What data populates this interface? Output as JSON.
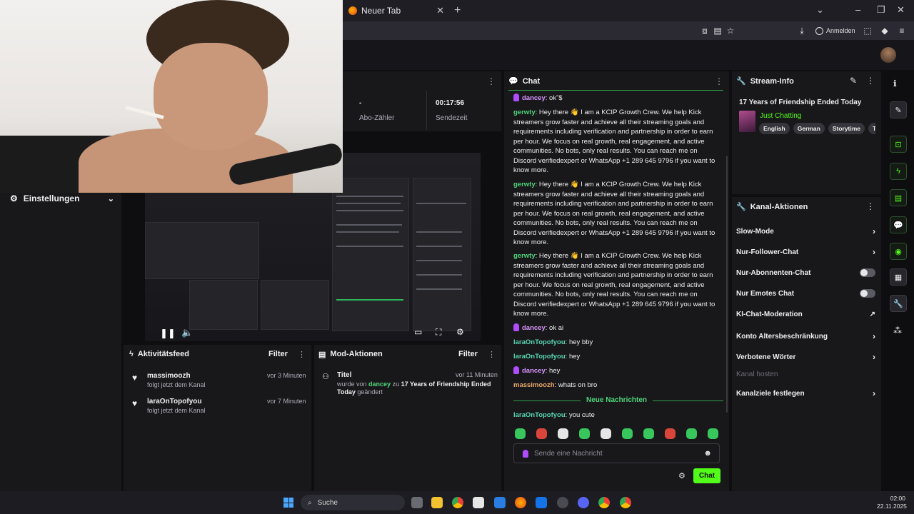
{
  "browser": {
    "tab_title": "Neuer Tab",
    "signin_label": "Anmelden"
  },
  "sidebar": {
    "settings_label": "Einstellungen"
  },
  "stats": {
    "subs_value": "-",
    "subs_label": "Abo-Zähler",
    "time_value": "00:17:56",
    "time_label": "Sendezeit"
  },
  "activity": {
    "title": "Aktivitätsfeed",
    "filter_label": "Filter",
    "items": [
      {
        "name": "massimoozh",
        "text": "folgt jetzt dem Kanal",
        "time": "vor 3 Minuten"
      },
      {
        "name": "laraOnTopofyou",
        "text": "folgt jetzt dem Kanal",
        "time": "vor 7 Minuten"
      }
    ]
  },
  "mod": {
    "title": "Mod-Aktionen",
    "filter_label": "Filter",
    "item": {
      "type": "Titel",
      "time": "vor 11 Minuten",
      "prefix": "wurde von",
      "user": "dancey",
      "middle": "zu",
      "target": "17 Years of Friendship Ended Today",
      "suffix": "geändert"
    }
  },
  "chat": {
    "title": "Chat",
    "messages": [
      {
        "user": "dancey",
        "text": "ok˜$"
      },
      {
        "user": "gerwty",
        "text": "Hey there 👋 I am a KCIP Growth Crew. We help Kick streamers grow faster and achieve all their streaming goals and requirements including verification and partnership in order to earn per hour. We focus on real growth, real engagement, and active communities. No bots, only real results. You can reach me on Discord verifiedexpert or WhatsApp +1 289 645 9796 if you want to know more."
      },
      {
        "user": "gerwty",
        "text": "Hey there 👋 I am a KCIP Growth Crew. We help Kick streamers grow faster and achieve all their streaming goals and requirements including verification and partnership in order to earn per hour. We focus on real growth, real engagement, and active communities. No bots, only real results. You can reach me on Discord verifiedexpert or WhatsApp +1 289 645 9796 if you want to know more."
      },
      {
        "user": "gerwty",
        "text": "Hey there 👋 I am a KCIP Growth Crew. We help Kick streamers grow faster and achieve all their streaming goals and requirements including verification and partnership in order to earn per hour. We focus on real growth, real engagement, and active communities. No bots, only real results. You can reach me on Discord verifiedexpert or WhatsApp +1 289 645 9796 if you want to know more."
      },
      {
        "user": "dancey",
        "text": "ok ai"
      },
      {
        "user": "laraOnTopofyou",
        "text": "hey bby"
      },
      {
        "user": "laraOnTopofyou",
        "text": "hey"
      },
      {
        "user": "dancey",
        "text": "hey"
      },
      {
        "user": "massimoozh",
        "text": "whats on bro"
      },
      {
        "user": "laraOnTopofyou",
        "text": "you cute"
      }
    ],
    "new_messages_label": "Neue Nachrichten",
    "input_placeholder": "Sende eine Nachricht",
    "send_label": "Chat"
  },
  "stream_info": {
    "title": "Stream-Info",
    "stream_title": "17 Years of Friendship Ended Today",
    "category": "Just Chatting",
    "tags": [
      "English",
      "German",
      "Storytime",
      "Tru"
    ]
  },
  "channel_actions": {
    "title": "Kanal-Aktionen",
    "items": [
      {
        "label": "Slow-Mode",
        "control": "chevron"
      },
      {
        "label": "Nur-Follower-Chat",
        "control": "chevron"
      },
      {
        "label": "Nur-Abonnenten-Chat",
        "control": "toggle"
      },
      {
        "label": "Nur Emotes Chat",
        "control": "toggle"
      },
      {
        "label": "KI-Chat-Moderation",
        "control": "external"
      },
      {
        "label": "Konto Altersbeschränkung",
        "control": "chevron"
      },
      {
        "label": "Verbotene Wörter",
        "control": "chevron"
      },
      {
        "label": "Kanal hosten",
        "control": "none"
      },
      {
        "label": "Kanalziele festlegen",
        "control": "chevron"
      }
    ]
  },
  "taskbar": {
    "search_label": "Suche",
    "time": "02:00",
    "date": "22.11.2025"
  },
  "colors": {
    "accent": "#53fc18",
    "panel": "#18181b",
    "background": "#0e0e10"
  }
}
